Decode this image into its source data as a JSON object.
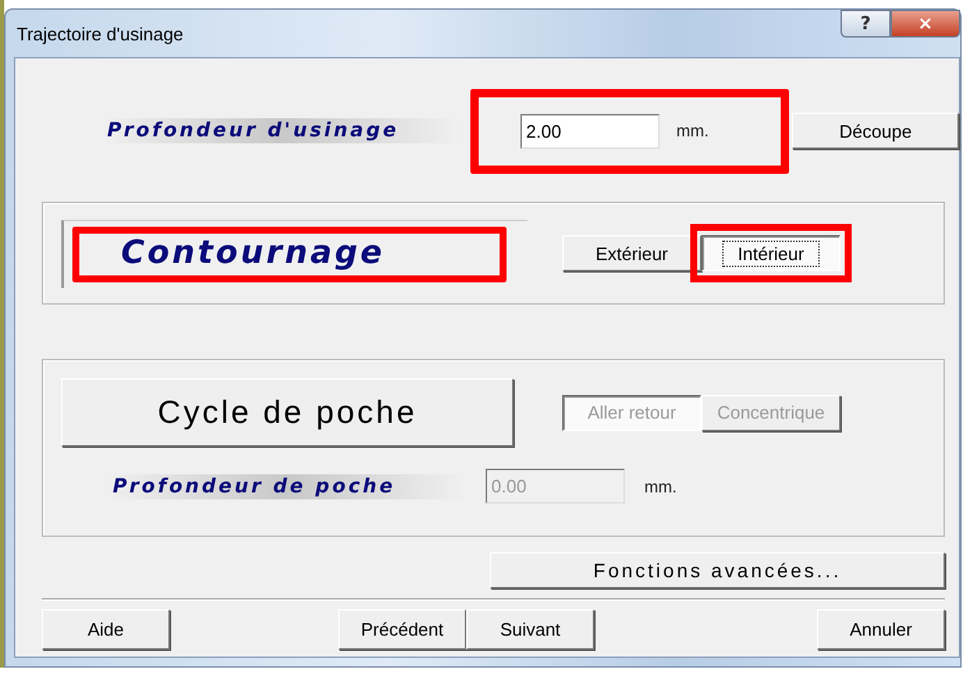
{
  "window": {
    "title": "Trajectoire d'usinage",
    "caption_buttons": [
      "?",
      "×"
    ]
  },
  "depth": {
    "label": "Profondeur d'usinage",
    "value": "2.00",
    "unit": "mm.",
    "highlighted": true,
    "button": "Découpe"
  },
  "contour": {
    "label": "Contournage",
    "highlighted": true,
    "options": [
      {
        "label": "Extérieur",
        "selected": false,
        "highlighted": false
      },
      {
        "label": "Intérieur",
        "selected": true,
        "highlighted": true
      }
    ]
  },
  "pocket": {
    "button": "Cycle de poche",
    "disabled": true,
    "options": [
      {
        "label": "Aller retour",
        "selected": true
      },
      {
        "label": "Concentrique",
        "selected": false
      }
    ],
    "depth_label": "Profondeur de poche",
    "depth_value": "0.00",
    "unit": "mm."
  },
  "advanced_button": "Fonctions avancées...",
  "footer_buttons": [
    {
      "label": "Aide"
    },
    {
      "label": "Précédent"
    },
    {
      "label": "Suivant"
    },
    {
      "label": "Annuler"
    }
  ]
}
